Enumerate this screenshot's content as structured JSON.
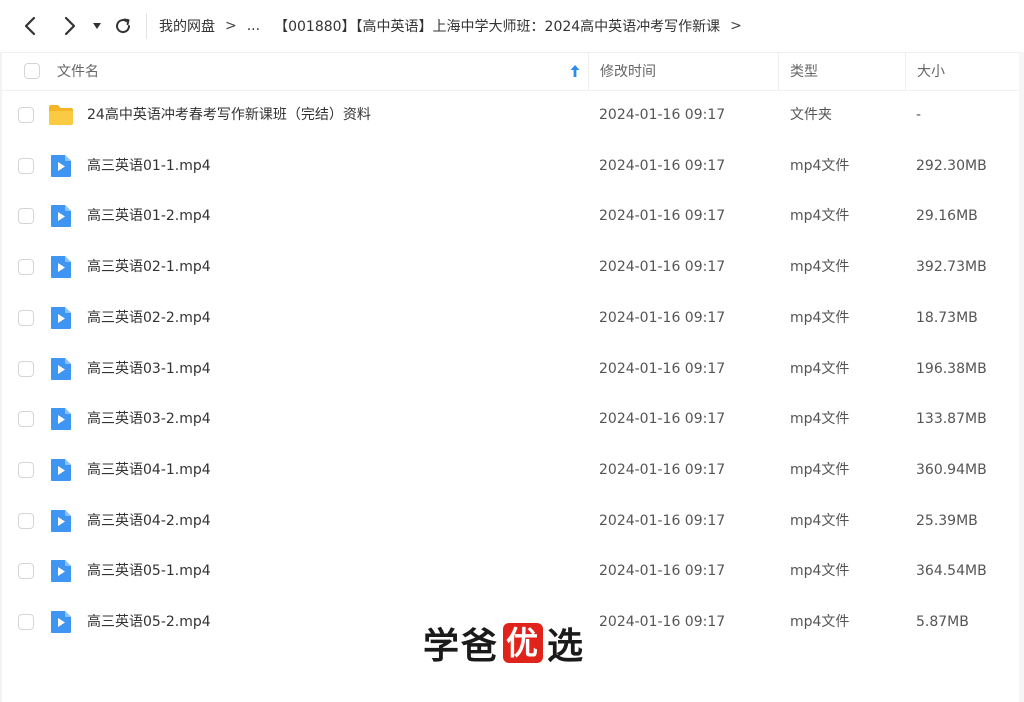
{
  "breadcrumb": {
    "root": "我的网盘",
    "ellipsis": "...",
    "current": "【001880】【高中英语】上海中学大师班：2024高中英语冲考写作新课"
  },
  "columns": {
    "name": "文件名",
    "modified": "修改时间",
    "type": "类型",
    "size": "大小"
  },
  "sort": {
    "column": "name",
    "direction": "ascending",
    "icon": "arrow-up-icon"
  },
  "colors": {
    "accent": "#2b8cf0",
    "folder": "#f7c23a",
    "video": "#2b8cf0"
  },
  "files": [
    {
      "name": "24高中英语冲考春考写作新课班（完结）资料",
      "time": "2024-01-16 09:17",
      "type": "文件夹",
      "size": "-",
      "icon": "folder-icon"
    },
    {
      "name": "高三英语01-1.mp4",
      "time": "2024-01-16 09:17",
      "type": "mp4文件",
      "size": "292.30MB",
      "icon": "video-file-icon"
    },
    {
      "name": "高三英语01-2.mp4",
      "time": "2024-01-16 09:17",
      "type": "mp4文件",
      "size": "29.16MB",
      "icon": "video-file-icon"
    },
    {
      "name": "高三英语02-1.mp4",
      "time": "2024-01-16 09:17",
      "type": "mp4文件",
      "size": "392.73MB",
      "icon": "video-file-icon"
    },
    {
      "name": "高三英语02-2.mp4",
      "time": "2024-01-16 09:17",
      "type": "mp4文件",
      "size": "18.73MB",
      "icon": "video-file-icon"
    },
    {
      "name": "高三英语03-1.mp4",
      "time": "2024-01-16 09:17",
      "type": "mp4文件",
      "size": "196.38MB",
      "icon": "video-file-icon"
    },
    {
      "name": "高三英语03-2.mp4",
      "time": "2024-01-16 09:17",
      "type": "mp4文件",
      "size": "133.87MB",
      "icon": "video-file-icon"
    },
    {
      "name": "高三英语04-1.mp4",
      "time": "2024-01-16 09:17",
      "type": "mp4文件",
      "size": "360.94MB",
      "icon": "video-file-icon"
    },
    {
      "name": "高三英语04-2.mp4",
      "time": "2024-01-16 09:17",
      "type": "mp4文件",
      "size": "25.39MB",
      "icon": "video-file-icon"
    },
    {
      "name": "高三英语05-1.mp4",
      "time": "2024-01-16 09:17",
      "type": "mp4文件",
      "size": "364.54MB",
      "icon": "video-file-icon"
    },
    {
      "name": "高三英语05-2.mp4",
      "time": "2024-01-16 09:17",
      "type": "mp4文件",
      "size": "5.87MB",
      "icon": "video-file-icon"
    }
  ],
  "watermark": {
    "part1": "学爸",
    "stamp": "优",
    "part2": "选"
  }
}
